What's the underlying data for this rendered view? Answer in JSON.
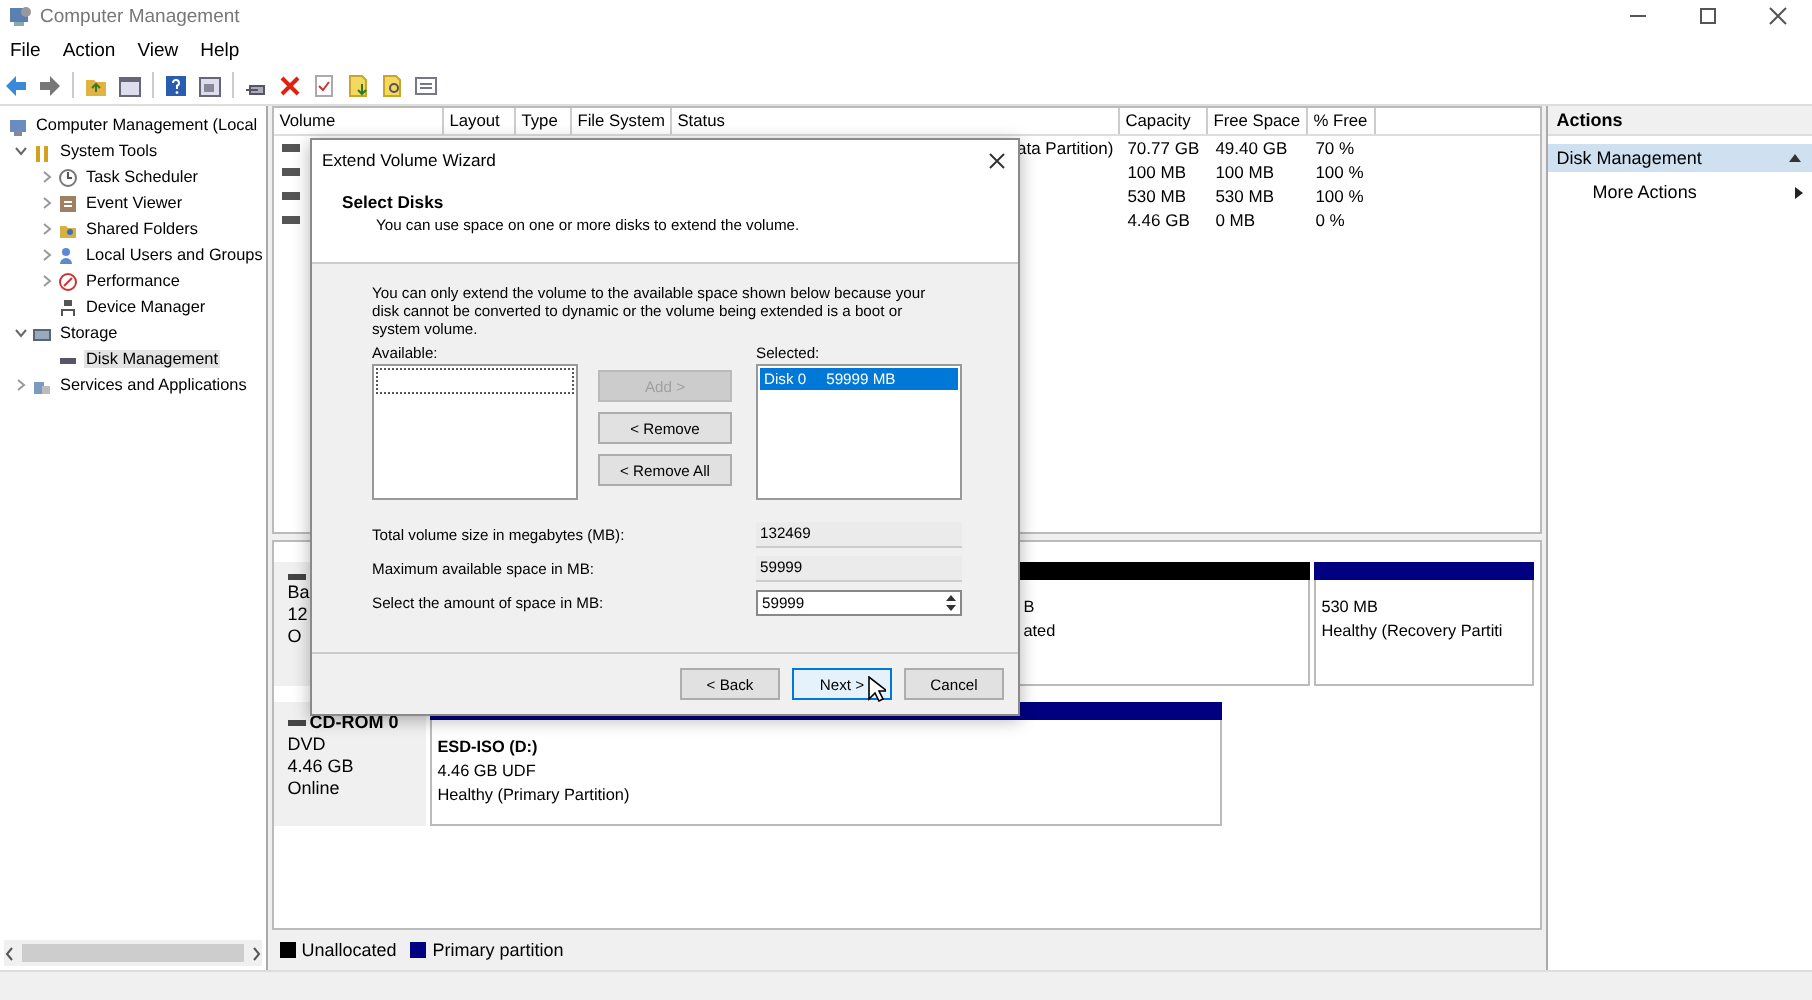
{
  "window": {
    "title": "Computer Management"
  },
  "menu": [
    "File",
    "Action",
    "View",
    "Help"
  ],
  "tree": [
    {
      "label": "Computer Management (Local",
      "selected": false,
      "children": [
        {
          "label": "System Tools",
          "expanded": true,
          "selected": false,
          "children": [
            {
              "label": "Task Scheduler",
              "expanded": false,
              "selected": false
            },
            {
              "label": "Event Viewer",
              "expanded": false,
              "selected": false
            },
            {
              "label": "Shared Folders",
              "expanded": false,
              "selected": false
            },
            {
              "label": "Local Users and Groups",
              "expanded": false,
              "selected": false
            },
            {
              "label": "Performance",
              "expanded": false,
              "selected": false
            },
            {
              "label": "Device Manager",
              "selected": false
            }
          ]
        },
        {
          "label": "Storage",
          "expanded": true,
          "selected": false,
          "children": [
            {
              "label": "Disk Management",
              "selected": true
            }
          ]
        },
        {
          "label": "Services and Applications",
          "expanded": false,
          "selected": false
        }
      ]
    }
  ],
  "volume_table": {
    "columns": [
      "Volume",
      "Layout",
      "Type",
      "File System",
      "Status",
      "Capacity",
      "Free Space",
      "% Free"
    ],
    "rows": [
      {
        "status": "ata Partition)",
        "capacity": "70.77 GB",
        "free_space": "49.40 GB",
        "percent_free": "70 %"
      },
      {
        "capacity": "100 MB",
        "free_space": "100 MB",
        "percent_free": "100 %"
      },
      {
        "capacity": "530 MB",
        "free_space": "530 MB",
        "percent_free": "100 %"
      },
      {
        "capacity": "4.46 GB",
        "free_space": "0 MB",
        "percent_free": "0 %"
      }
    ]
  },
  "disks": [
    {
      "label_lines": [
        "Ba",
        "12",
        "O"
      ],
      "partitions": [
        {
          "color": "#000000",
          "lines": [
            "B",
            "ated"
          ]
        },
        {
          "color": "#000080",
          "lines": [
            "530 MB",
            "Healthy (Recovery Partiti"
          ]
        }
      ]
    },
    {
      "name": "CD-ROM 0",
      "label_lines": [
        "DVD",
        "4.46 GB",
        "Online"
      ],
      "partitions": [
        {
          "color": "#000080",
          "name": "ESD-ISO  (D:)",
          "lines": [
            "4.46 GB UDF",
            "Healthy (Primary Partition)"
          ]
        }
      ]
    }
  ],
  "legend": [
    {
      "label": "Unallocated",
      "color": "#000000"
    },
    {
      "label": "Primary partition",
      "color": "#000080"
    }
  ],
  "actions": {
    "title": "Actions",
    "sections": [
      {
        "label": "Disk Management",
        "expanded": true,
        "items": [
          "More Actions"
        ]
      }
    ]
  },
  "wizard": {
    "title": "Extend Volume Wizard",
    "heading": "Select Disks",
    "subtitle": "You can use space on one or more disks to extend the volume.",
    "note": "You can only extend the volume to the available space shown below because your disk cannot be converted to dynamic or the volume being extended is a boot or system volume.",
    "available_label": "Available:",
    "selected_label": "Selected:",
    "move_buttons": [
      {
        "label": "Add >",
        "disabled": true
      },
      {
        "label": "< Remove",
        "disabled": false
      },
      {
        "label": "< Remove All",
        "disabled": false
      }
    ],
    "selected_disks": [
      {
        "disk": "Disk 0",
        "size": "59999 MB",
        "selected": true
      }
    ],
    "fields": [
      {
        "kind": "readonly",
        "label": "Total volume size in megabytes (MB):",
        "value": "132469"
      },
      {
        "kind": "readonly",
        "label": "Maximum available space in MB:",
        "value": "59999"
      },
      {
        "kind": "spinner",
        "label": "Select the amount of space in MB:",
        "value": "59999"
      }
    ],
    "footer_buttons": [
      {
        "label": "< Back",
        "default": false
      },
      {
        "label": "Next >",
        "default": true
      },
      {
        "label": "Cancel",
        "default": false
      }
    ]
  }
}
